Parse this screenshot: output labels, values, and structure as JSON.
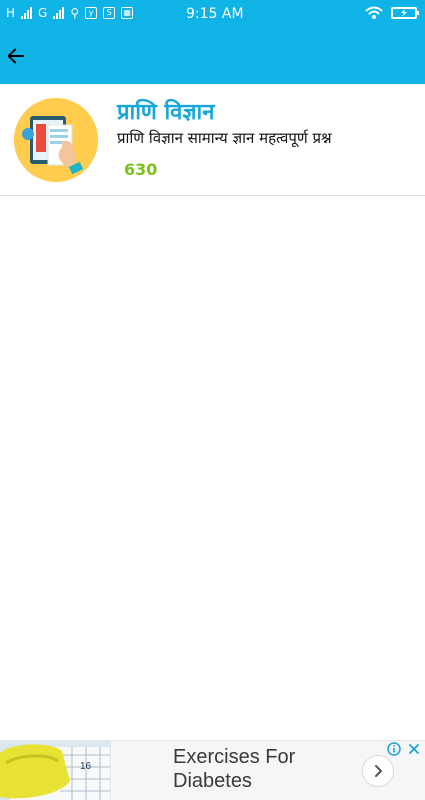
{
  "status_bar": {
    "network_1": "H",
    "network_2": "G",
    "time": "9:15 AM"
  },
  "header": {
    "back_icon": "arrow-left-icon"
  },
  "card": {
    "title": "प्राणि विज्ञान",
    "subtitle": "प्राणि विज्ञान सामान्य ज्ञान महत्वपूर्ण प्रश्न",
    "count": "630"
  },
  "ad": {
    "text": "Exercises For Diabetes",
    "next_icon": "chevron-right-icon",
    "info_icon": "info-icon",
    "close_icon": "close-icon"
  },
  "colors": {
    "header_bg": "#0fb3e6",
    "title": "#15a7d7",
    "count": "#7bc21b"
  }
}
